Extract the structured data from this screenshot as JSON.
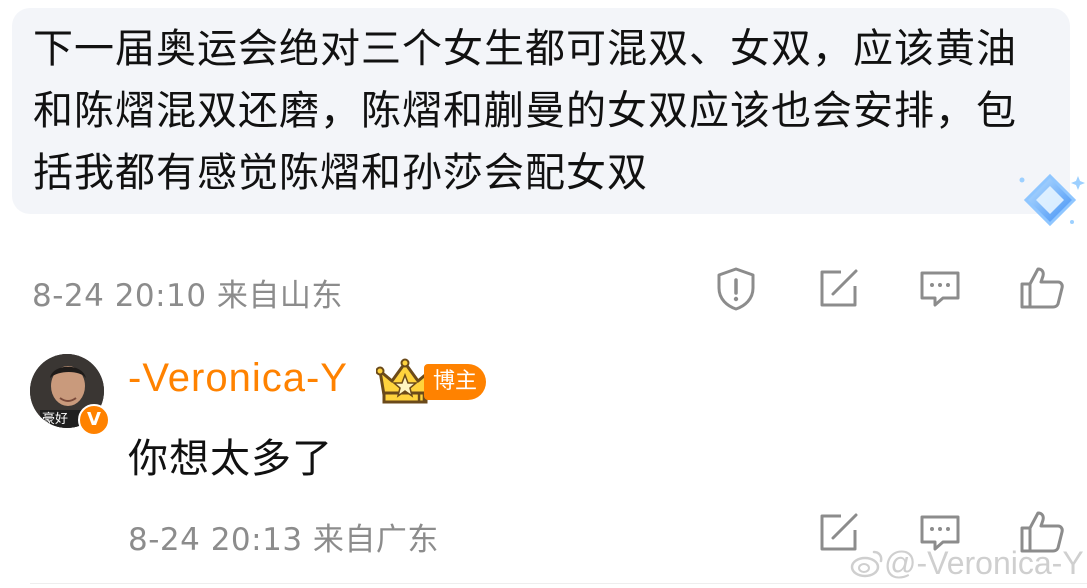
{
  "comment": {
    "text": "下一届奥运会绝对三个女生都可混双、女双，应该黄油和陈熠混双还磨，陈熠和蒯曼的女双应该也会安排，包括我都有感觉陈熠和孙莎会配女双",
    "meta": "8-24 20:10 来自山东"
  },
  "reply": {
    "username": "-Veronica-Y",
    "role_badge": "博主",
    "crown_level": "Ⅱ",
    "avatar_label": "豪好",
    "verified_badge": "V",
    "text": "你想太多了",
    "meta": "8-24 20:13 来自广东"
  },
  "watermark": "@-Veronica-Y",
  "colors": {
    "accent": "#ff8200",
    "text": "#111111",
    "meta": "#8c8c8c",
    "bubble": "#f3f5f9",
    "icon": "#8c8c8c"
  },
  "icons": [
    "exclamation-shield-icon",
    "share-edit-icon",
    "comment-icon",
    "thumbs-up-icon",
    "diamond-sparkle-icon",
    "crown-icon",
    "weibo-logo-icon"
  ]
}
